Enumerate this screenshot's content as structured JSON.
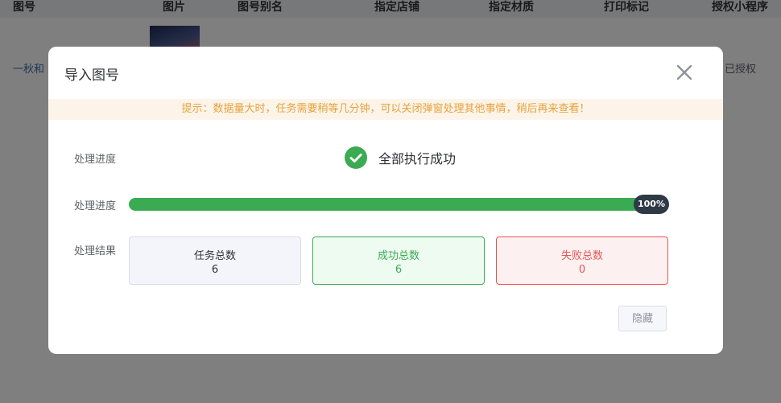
{
  "background": {
    "columns": [
      "图号",
      "图片",
      "图号别名",
      "指定店铺",
      "指定材质",
      "打印标记",
      "授权小程序"
    ],
    "row": {
      "name": "一秋和",
      "auth_status": "已授权"
    }
  },
  "modal": {
    "title": "导入图号",
    "close_icon": "close-icon",
    "tip": "提示：数据量大时，任务需要稍等几分钟，可以关闭弹窗处理其他事情，稍后再来查看！",
    "status_label": "处理进度",
    "status_text": "全部执行成功",
    "progress_label": "处理进度",
    "progress_percent": 100,
    "progress_text": "100%",
    "result_label": "处理结果",
    "cards": {
      "total": {
        "title": "任务总数",
        "value": "6"
      },
      "success": {
        "title": "成功总数",
        "value": "6"
      },
      "fail": {
        "title": "失败总数",
        "value": "0"
      }
    },
    "hide_button": "隐藏"
  },
  "colors": {
    "success_green": "#3bab53",
    "fail_red": "#e85454",
    "tip_orange": "#e6a23c",
    "badge_dark": "#2e3a46"
  }
}
